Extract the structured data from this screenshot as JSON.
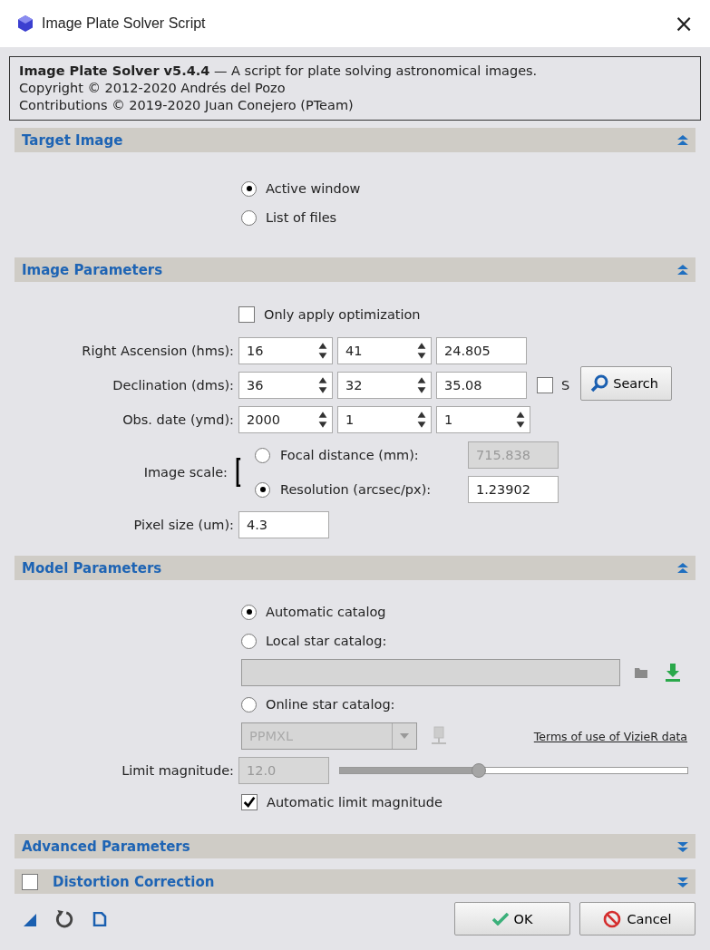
{
  "window": {
    "title": "Image Plate Solver Script",
    "close": "×"
  },
  "info": {
    "lines": [
      "**Image Plate Solver v5.4.4** — A script for plate solving astronomical images.",
      "Copyright © 2012-2020 Andrés del Pozo",
      "Contributions © 2019-2020 Juan Conejero (PTeam)"
    ]
  },
  "target_section": {
    "title": "Target Image",
    "expanded": true
  },
  "target_options": [
    {
      "label": "Active window",
      "selected": true
    },
    {
      "label": "List of files",
      "selected": false
    }
  ],
  "image_section": {
    "title": "Image Parameters",
    "expanded": true
  },
  "only_optimization": {
    "label": "Only apply optimization",
    "checked": false
  },
  "coordinate_rows": [
    {
      "label": "Right Ascension (hms):",
      "fields": [
        {
          "value": "16",
          "kind": "spin"
        },
        {
          "value": "41",
          "kind": "spin"
        },
        {
          "value": "24.805",
          "kind": "plain"
        }
      ]
    },
    {
      "label": "Declination (dms):",
      "fields": [
        {
          "value": "36",
          "kind": "spin"
        },
        {
          "value": "32",
          "kind": "spin"
        },
        {
          "value": "35.08",
          "kind": "plain"
        }
      ],
      "south": {
        "label": "S",
        "checked": false
      }
    },
    {
      "label": "Obs. date (ymd):",
      "fields": [
        {
          "value": "2000",
          "kind": "spin"
        },
        {
          "value": "1",
          "kind": "spin"
        },
        {
          "value": "1",
          "kind": "spin"
        }
      ]
    }
  ],
  "search_button": "Search",
  "image_scale": {
    "label": "Image scale:",
    "options": [
      {
        "label": "Focal distance (mm):",
        "value": "715.838",
        "selected": false
      },
      {
        "label": "Resolution (arcsec/px):",
        "value": "1.23902",
        "selected": true
      }
    ]
  },
  "pixel_size": {
    "label": "Pixel size (um):",
    "value": "4.3"
  },
  "model_section": {
    "title": "Model Parameters",
    "expanded": true
  },
  "catalog_options": [
    {
      "label": "Automatic catalog",
      "selected": true,
      "kind": "automatic"
    },
    {
      "label": "Local star catalog:",
      "selected": false,
      "kind": "local"
    },
    {
      "label": "Online star catalog:",
      "selected": false,
      "kind": "online"
    }
  ],
  "online_catalog": "PPMXL",
  "vizier_link": "Terms of use of VizieR data",
  "limit_magnitude": {
    "label": "Limit magnitude:",
    "value": "12.0",
    "level": 0.4
  },
  "automatic_limit": {
    "label": "Automatic limit magnitude",
    "checked": true
  },
  "advanced_section": {
    "title": "Advanced Parameters",
    "expanded": false
  },
  "distortion_section": {
    "title": "Distortion Correction",
    "expanded": false,
    "checked": false
  },
  "buttons": [
    {
      "label": "OK",
      "kind": "ok"
    },
    {
      "label": "Cancel",
      "kind": "cancel"
    }
  ]
}
